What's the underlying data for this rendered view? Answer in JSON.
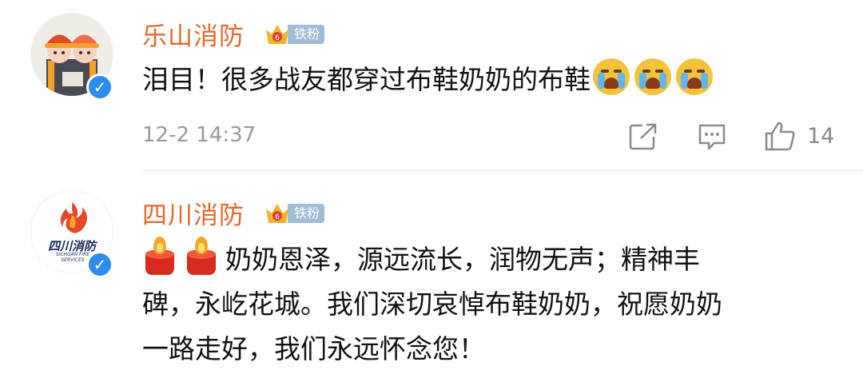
{
  "comments": [
    {
      "username": "乐山消防",
      "fan_badge": "铁粉",
      "text": "泪目！很多战友都穿过布鞋奶奶的布鞋",
      "emoji": "crying-face-icon",
      "timestamp": "12-2 14:37",
      "like_count": "14"
    },
    {
      "username": "四川消防",
      "fan_badge": "铁粉",
      "emoji": "candle-icon",
      "text_line1": "奶奶恩泽，源远流长，润物无声；精神丰",
      "text_line2": "碑，永屹花城。我们深切哀悼布鞋奶奶，祝愿奶奶",
      "text_line3": "一路走好，我们永远怀念您！",
      "avatar_logo_text": "四川消防",
      "avatar_logo_sub": "SICHUAN FIRE SERVICES"
    }
  ],
  "colors": {
    "username": "#e5672c",
    "verified": "#2d8cf0",
    "fan_badge": "#9fbcd6",
    "meta": "#999999"
  }
}
